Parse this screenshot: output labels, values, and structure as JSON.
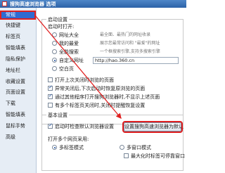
{
  "window": {
    "title": "搜狗高速浏览器 选项"
  },
  "sidebar": {
    "items": [
      {
        "label": "常规"
      },
      {
        "label": "快捷键"
      },
      {
        "label": "标签页"
      },
      {
        "label": "智能填表"
      },
      {
        "label": "隐私保护"
      },
      {
        "label": "地址栏"
      },
      {
        "label": "收藏设置"
      },
      {
        "label": "页面设置"
      },
      {
        "label": "下载"
      },
      {
        "label": "智能填表"
      },
      {
        "label": "鼠标手势"
      },
      {
        "label": "高级"
      }
    ]
  },
  "startup": {
    "group_title": "启动设置",
    "open_label": "启动时打开:",
    "options": [
      {
        "label": "网址大全",
        "desc": "最全面、最热门的网址收录"
      },
      {
        "label": "我的最爱",
        "desc": "展示您最常访问和 \"最爱\"的网址"
      },
      {
        "label": "全能搜索",
        "desc": "一个框搜索引擎,支持多搜索引擎"
      },
      {
        "label": "自定义网址"
      },
      {
        "label": "空白页"
      }
    ],
    "custom_url": "http://hao.360.cn",
    "checks": [
      {
        "label": "打开上次关闭时浏览的页面"
      },
      {
        "label": "异常关闭后,下次启动时恢复原浏览的页面"
      },
      {
        "label": "通过其他程序打开搜狗浏览器时,不显示上述页面"
      },
      {
        "label": "有多个标签页关闭时,关闭时提醒恢复设置"
      }
    ]
  },
  "basic": {
    "group_title": "基本设置",
    "check_default_label": "启动时检查默认浏览器设置",
    "set_default_button": "设置搜狗高速浏览器为默认",
    "new_page_label": "打开多个网页采用:",
    "modes": [
      {
        "label": "多标签模式"
      },
      {
        "label": "多窗口模式"
      }
    ],
    "mode_desc": "最大化时标签可停靠窗口"
  },
  "colors": {
    "accent": "#2f6bd1",
    "highlight": "#e02020"
  }
}
